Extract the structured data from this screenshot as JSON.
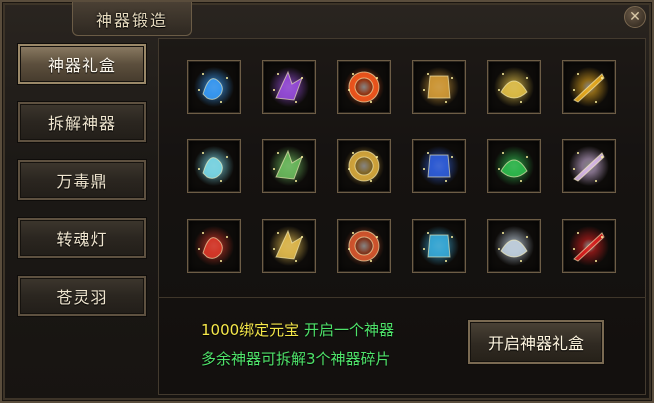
{
  "window": {
    "title": "神器锻造",
    "close_symbol": "✕"
  },
  "sidebar": {
    "items": [
      {
        "label": "神器礼盒",
        "active": true
      },
      {
        "label": "拆解神器",
        "active": false
      },
      {
        "label": "万毒鼎",
        "active": false
      },
      {
        "label": "转魂灯",
        "active": false
      },
      {
        "label": "苍灵羽",
        "active": false
      }
    ]
  },
  "artifacts": [
    {
      "icon": "blue-dragon-icon",
      "color": "#3aa0ff"
    },
    {
      "icon": "purple-wing-icon",
      "color": "#9b4fe0"
    },
    {
      "icon": "fire-ring-icon",
      "color": "#ff5a1e"
    },
    {
      "icon": "golden-beast-icon",
      "color": "#d9a03a"
    },
    {
      "icon": "golden-scroll-icon",
      "color": "#e8c64a"
    },
    {
      "icon": "golden-ring-icon",
      "color": "#f0b020"
    },
    {
      "icon": "ice-flame-icon",
      "color": "#7fe0f0"
    },
    {
      "icon": "jade-relic-icon",
      "color": "#6fc060"
    },
    {
      "icon": "golden-crossbow-icon",
      "color": "#e0b040"
    },
    {
      "icon": "blue-orb-icon",
      "color": "#3060e0"
    },
    {
      "icon": "green-orb-icon",
      "color": "#30c050"
    },
    {
      "icon": "crystal-flower-icon",
      "color": "#e0c0f0"
    },
    {
      "icon": "red-banner-icon",
      "color": "#e03a2a"
    },
    {
      "icon": "golden-blade-icon",
      "color": "#e8c050"
    },
    {
      "icon": "flame-tower-icon",
      "color": "#e05a30"
    },
    {
      "icon": "blue-tassel-icon",
      "color": "#3ab0e0"
    },
    {
      "icon": "silver-sword-icon",
      "color": "#c8d8e8"
    },
    {
      "icon": "red-rune-orb-icon",
      "color": "#e02020"
    }
  ],
  "info": {
    "cost": "1000绑定元宝",
    "action": "开启一个神器",
    "note": "多余神器可拆解3个神器碎片"
  },
  "open_button": {
    "label": "开启神器礼盒"
  },
  "colors": {
    "highlight_yellow": "#f6e84a",
    "highlight_green": "#4fe36a"
  }
}
